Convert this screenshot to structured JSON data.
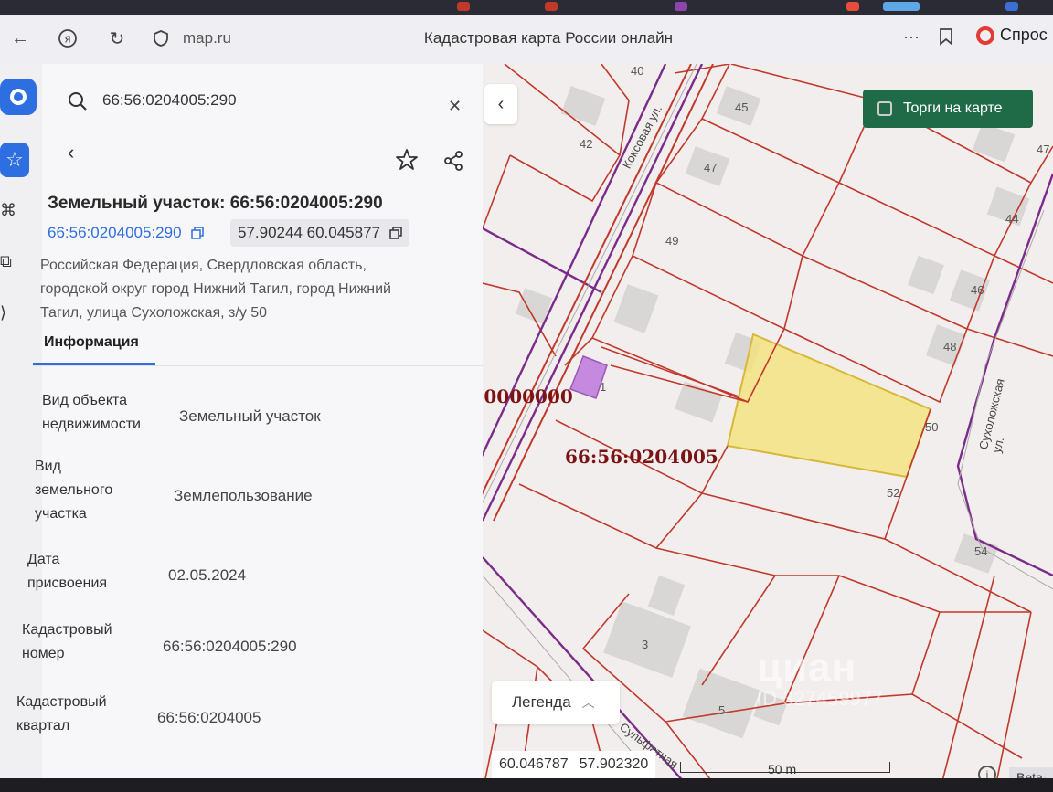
{
  "browser": {
    "url": "map.ru",
    "tab_title": "Кадастровая карта России онлайн",
    "ask_label": "Спрос"
  },
  "search": {
    "value": "66:56:0204005:290"
  },
  "object": {
    "title": "Земельный участок: 66:56:0204005:290",
    "cadastral_link": "66:56:0204005:290",
    "coordinates": "57.90244 60.045877",
    "address_lines": [
      "Российская Федерация, Свердловская область,",
      "городской округ город Нижний Тагил, город Нижний",
      "Тагил, улица Сухоложская, з/у 50"
    ]
  },
  "tabs": {
    "info": "Информация"
  },
  "fields": [
    {
      "label_lines": [
        "Вид объекта",
        "недвижимости"
      ],
      "value": "Земельный участок"
    },
    {
      "label_lines": [
        "Вид",
        "земельного",
        "участка"
      ],
      "value": "Землепользование"
    },
    {
      "label_lines": [
        "Дата",
        "присвоения"
      ],
      "value": "02.05.2024"
    },
    {
      "label_lines": [
        "Кадастровый",
        "номер"
      ],
      "value": "66:56:0204005:290"
    },
    {
      "label_lines": [
        "Кадастровый",
        "квартал"
      ],
      "value": "66:56:0204005"
    }
  ],
  "map": {
    "torgi_label": "Торги на карте",
    "legend_label": "Легенда",
    "quarter_label": "66:56:0204005",
    "quarter_label_partial": ":0000000",
    "street_koksovaya": "Коксовая ул.",
    "street_sukholozhskaya": "Сухоложская ул.",
    "street_sulfatnaya": "Сульфатная",
    "house_numbers": [
      "40",
      "42",
      "45",
      "47",
      "47",
      "44",
      "49",
      "46",
      "48",
      "1",
      "50",
      "52",
      "54",
      "3",
      "5"
    ],
    "cursor_lon": "60.046787",
    "cursor_lat": "57.902320",
    "scale": "50 m",
    "beta": "Beta-"
  },
  "watermark": {
    "brand": "циан",
    "id": "ID 327459977"
  },
  "colors": {
    "accent": "#2f6fdc",
    "parcel_border": "#c0392b",
    "highlight_parcel": "#f3e27a",
    "street_line": "#7b2c8a",
    "torgi_bg": "#1f6b47"
  }
}
